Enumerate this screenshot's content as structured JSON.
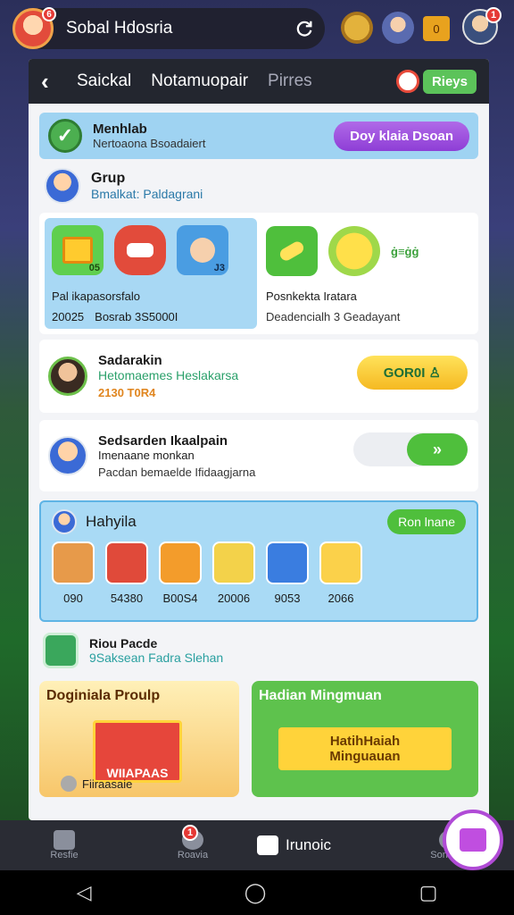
{
  "topbar": {
    "avatar_badge": "6",
    "profile_name": "Sobal Hdosria",
    "right_badge": "1",
    "coin_label": "0"
  },
  "header": {
    "tabs": [
      "Saickal",
      "Notamuopair",
      "Pirres"
    ],
    "new_label": "Rieys"
  },
  "banner": {
    "title": "Menhlab",
    "subtitle": "Nertoaona Bsoadaiert",
    "button_label": "Doy klaia Dsoan"
  },
  "group": {
    "title": "Grup",
    "subtitle": "Bmalkat: Paldagrani"
  },
  "rewards": {
    "left_title": "Pal ikapasorsfalo",
    "left_value1": "20025",
    "left_value2": "Bosrab 3S5000I",
    "right_title": "Posnkekta Iratara",
    "right_sub": "Deadencialh 3 Geadayant",
    "right_badge": "ġ≡ġġ",
    "tile1_label": "05",
    "tile2_label": "J3"
  },
  "streak": {
    "title": "Sadarakin",
    "subtitle": "Hetomaemes Heslakarsa",
    "value": "2130 T0R4",
    "button_label": "GOR0I ♙"
  },
  "invite": {
    "title": "Sedsarden Ikaalpain",
    "subtitle": "Imenaane monkan",
    "detail": "Pacdan bemaelde Ifidaagjarna",
    "toggle_label": "»"
  },
  "friends": {
    "title": "Hahyila",
    "button_label": "Ron lnane",
    "items": [
      {
        "value": "090",
        "color": "#e79a4a"
      },
      {
        "value": "54380",
        "color": "#e04a3a"
      },
      {
        "value": "B00S4",
        "color": "#f39c2b"
      },
      {
        "value": "20006",
        "color": "#f3d24a"
      },
      {
        "value": "9053",
        "color": "#3a7de0"
      },
      {
        "value": "2066",
        "color": "#fbd14a"
      }
    ]
  },
  "feature": {
    "title": "Riou Pacde",
    "subtitle": "9Saksean Fadra Slehan"
  },
  "promos": {
    "left_title": "Doginiala Proulp",
    "left_gift_label": "WIIAPAAS",
    "left_footer": "Fiiraasaie",
    "right_title": "Hadian Mingmuan",
    "right_ribbon1": "HatihHaiah",
    "right_ribbon2": "Minguauan"
  },
  "nav": {
    "items": [
      "Resfie",
      "Roavia",
      "Irunoic",
      "Sonaens"
    ],
    "badge": "1"
  }
}
